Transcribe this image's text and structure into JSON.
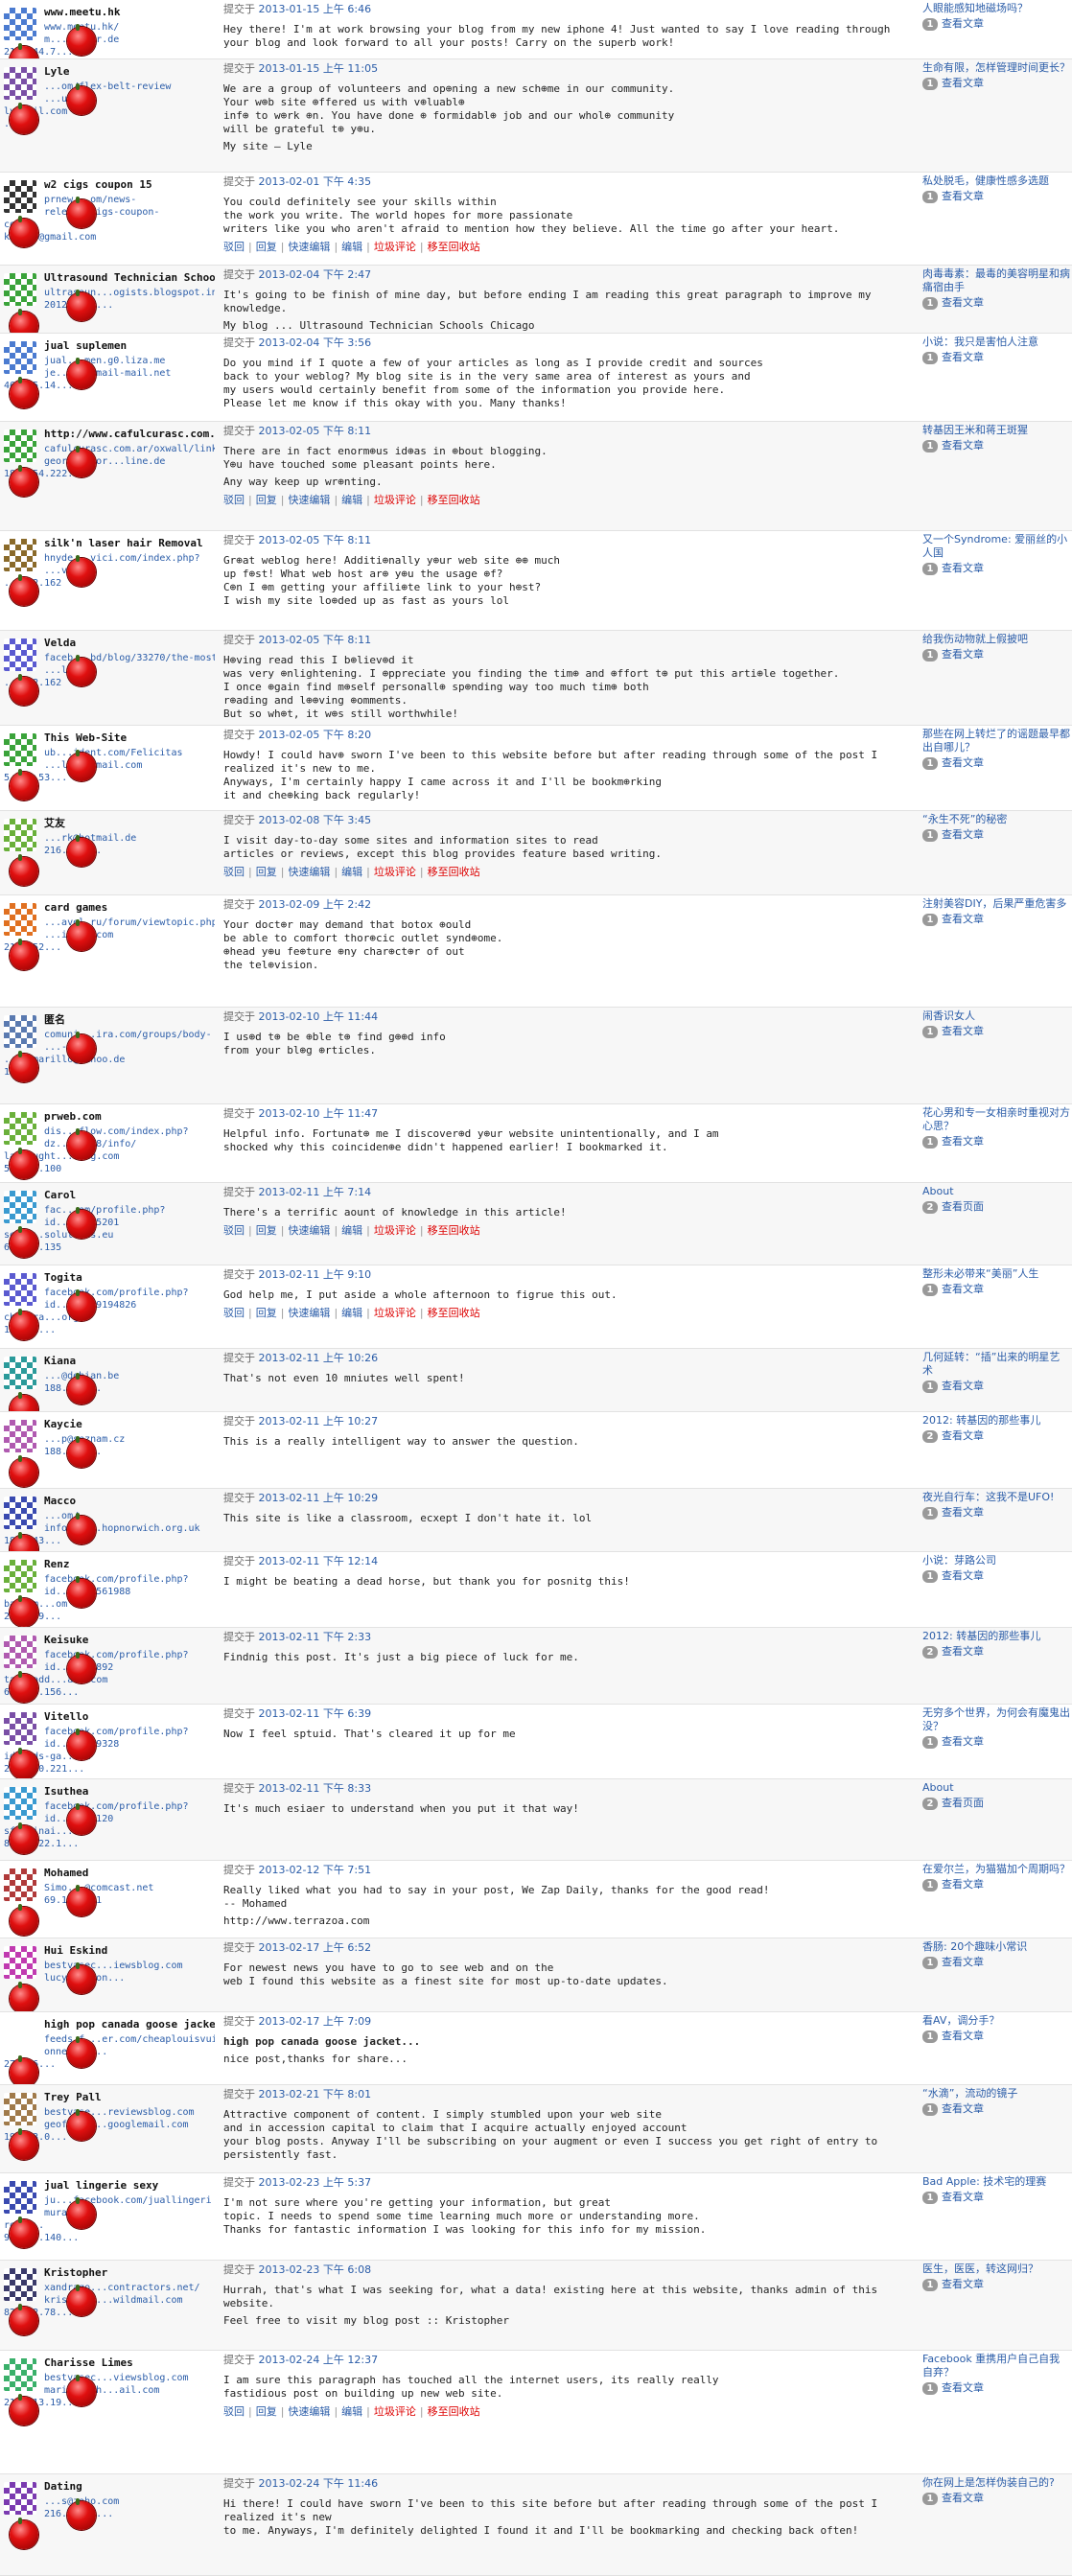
{
  "ui": {
    "submitted_prefix": "提交于",
    "actions": [
      "驳回",
      "回复",
      "快速编辑",
      "编辑",
      "垃圾评论",
      "移至回收站"
    ],
    "view_post": "查看文章",
    "view_page": "查看页面"
  },
  "rows": [
    {
      "name": "www.meetu.hk",
      "meta": [
        "www.meetu.hk/",
        "m...@arcor.de",
        "216.244.7..."
      ],
      "date": "2013-01-15 上午 6:46",
      "body": [
        "Hey there! I'm at work browsing your blog from my new iphone 4! Just wanted to say I love reading through your blog and look forward to all your posts! Carry on the superb work!"
      ],
      "actions": false,
      "post": "人眼能感知地磁场吗？",
      "count": "1",
      "view": "查看文章",
      "avatar": "#4b7bd0"
    },
    {
      "name": "Lyle",
      "meta": [
        "...om/flex-belt-review",
        "...unt",
        "ly...il.com",
        "...70"
      ],
      "date": "2013-01-15 上午 11:05",
      "body": [
        "We are a group of volunteers and op⊕ning a new sch⊕me in our community.\nYour w⊕b site ⊕ffered us with v⊕luabl⊕\ninf⊕ to w⊕rk ⊕n. You have done ⊕ formidabl⊕ job and our whol⊕ community\nwill be grateful t⊕ y⊕u.",
        "My site – Lyle"
      ],
      "actions": false,
      "post": "生命有限，怎样管理时间更长？",
      "count": "1",
      "view": "查看文章",
      "avatar": "#7a4fa6"
    },
    {
      "name": "w2 cigs coupon 15",
      "meta": [
        "prnew...om/news-",
        "relea...cigs-coupon-",
        "co/",
        "kay...@gmail.com"
      ],
      "date": "2013-02-01 下午 4:35",
      "body": [
        "You could definitely see your skills within\nthe work you write. The world hopes for more passionate\nwriters like you who aren't afraid to mention how they believe. All the time go after your heart."
      ],
      "actions": true,
      "post": "私处脱毛，健康性感多选题",
      "count": "1",
      "view": "查看文章",
      "avatar": "#333333"
    },
    {
      "name": "Ultrasound Technician Schools Chicago",
      "meta": [
        "ultrasoun...ogists.blogspot.in/",
        "2012/12/u..."
      ],
      "date": "2013-02-04 下午 2:47",
      "body": [
        "It's going to be finish of mine day, but before ending I am reading this great paragraph to improve my knowledge.",
        "My blog ... Ultrasound Technician Schools Chicago"
      ],
      "actions": false,
      "post": "肉毒毒素：最毒的美容明星和病痛宿由手",
      "count": "1",
      "view": "查看文章",
      "avatar": "#3aa33a"
    },
    {
      "name": "jual suplemen",
      "meta": [
        "jual...men.g0.liza.me",
        "je...ain@mail-mail.net",
        "46.105.14..."
      ],
      "date": "2013-02-04 下午 3:56",
      "body": [
        "Do you mind if I quote a few of your articles as long as I provide credit and sources\nback to your weblog? My blog site is in the very same area of interest as yours and\nmy users would certainly benefit from some of the information you provide here.\nPlease let me know if this okay with you. Many thanks!"
      ],
      "actions": false,
      "post": "小说：我只是害怕人注意",
      "count": "1",
      "view": "查看文章",
      "avatar": "#4b7bd0"
    },
    {
      "name": "http://www.cafulcurasc.com.ar/",
      "meta": [
        "cafulcurasc.com.ar/oxwall/link/14419",
        "georgesobor...line.de",
        "184.154.222..."
      ],
      "date": "2013-02-05 下午 8:11",
      "body": [
        "There are in fact enorm⊕us id⊕as in ⊕bout blogging.\nY⊕u have touched some pleasant points here.",
        "Any way keep up wr⊕nting."
      ],
      "actions": true,
      "post": "转基因王米和蒋王斑猩",
      "count": "1",
      "view": "查看文章",
      "avatar": "#3aa33a"
    },
    {
      "name": "silk'n laser hair Removal",
      "meta": [
        "hnyde...vici.com/index.php?",
        "...vi...",
        "...222.162"
      ],
      "date": "2013-02-05 下午 8:11",
      "body": [
        "Gr⊕at weblog here! Additi⊕nally y⊕ur web site ⊕⊕ much\nup f⊕st! What web host ar⊕ y⊕u the usage ⊕f?\nC⊕n I ⊕m getting your affili⊕te link to your h⊕st?\nI wish my site lo⊕ded up as fast as yours lol"
      ],
      "actions": false,
      "post": "又一个Syndrome: 爱丽丝的小人国",
      "count": "1",
      "view": "查看文章",
      "avatar": "#8a6a2a"
    },
    {
      "name": "Velda",
      "meta": [
        "faceb...bd/blog/33270/the-most-",
        "...l.com",
        "...222.162"
      ],
      "date": "2013-02-05 下午 8:11",
      "body": [
        "H⊕ving read this I b⊕liev⊕d it\nwas very ⊕nlightening. I ⊕ppreciate you finding the tim⊕ and ⊕ffort t⊕ put this arti⊕le together.\nI once ⊕gain find m⊕self personall⊕ sp⊕nding way too much tim⊕ both\nr⊕ading and l⊕⊕ving ⊕omments.\nBut so wh⊕t, it w⊕s still worthwhile!"
      ],
      "actions": false,
      "post": "给我伤动物就上假披吧",
      "count": "1",
      "view": "查看文章",
      "avatar": "#5a5ad0"
    },
    {
      "name": "This Web-Site",
      "meta": [
        "ub...ident.com/Felicitas",
        "...llon@gmail.com",
        "5.135.53..."
      ],
      "date": "2013-02-05 下午 8:20",
      "body": [
        "Howdy! I could hav⊕ sworn I've been to this website before but after reading through some of the post I realized it's new to me.\nAnyways, I'm certainly happy I came across it and I'll be bookm⊕rking\nit and che⊕king back regularly!"
      ],
      "actions": false,
      "post": "那些在网上转烂了的谣题最早都出自哪儿？",
      "count": "1",
      "view": "查看文章",
      "avatar": "#3aa33a"
    },
    {
      "name": "艾友",
      "meta": [
        "...rk@hotmail.de",
        "216.244..."
      ],
      "date": "2013-02-08 下午 3:45",
      "body": [
        "I visit day-to-day some sites and information sites to read\narticles or reviews, except this blog provides feature based writing."
      ],
      "actions": true,
      "post": "“永生不死”的秘密",
      "count": "1",
      "view": "查看文章",
      "avatar": "#6ab03a"
    },
    {
      "name": "card games",
      "meta": [
        "...avel.ru/forum/viewtopic.php?",
        "...inbox.com",
        "216.152..."
      ],
      "date": "2013-02-09 上午 2:42",
      "body": [
        "Your doct⊕r may demand that botox ⊕ould\nbe able to comfort thor⊕cic outlet synd⊕ome.\n⊕head y⊕u fe⊕ture ⊕ny char⊕ct⊕r of out\nthe tel⊕vision."
      ],
      "actions": false,
      "post": "注射美容DIY，后果严重危害多",
      "count": "1",
      "view": "查看文章",
      "avatar": "#e07020"
    },
    {
      "name": "匿名",
      "meta": [
        "comuni...ira.com/groups/body-",
        "...-fo...",
        "...camarillo@yahoo.de",
        "100"
      ],
      "date": "2013-02-10 上午 11:44",
      "body": [
        "I us⊕d t⊕ be ⊕ble t⊕ find g⊕⊕d info\nfrom your bl⊕g ⊕rticles."
      ],
      "actions": false,
      "post": "闹香识女人",
      "count": "1",
      "view": "查看文章",
      "avatar": "#5a7ab0"
    },
    {
      "name": "prweb.com",
      "meta": [
        "dis...flow.com/index.php?",
        "dz...e-278/info/",
        "landaught...ring.com",
        "5.39.1.100"
      ],
      "date": "2013-02-10 上午 11:47",
      "body": [
        "Helpful info. Fortunat⊕ me I discover⊕d y⊕ur website unintentionally, and I am\nshocked why this coinciden⊕e didn't happened earlier! I bookmarked it."
      ],
      "actions": false,
      "post": "花心男和专一女相亲时重视对方心思？",
      "count": "1",
      "view": "查看文章",
      "avatar": "#6ab03a"
    },
    {
      "name": "Carol",
      "meta": [
        "fac...om/profile.php?",
        "id...08985201",
        "serv...solutions.eu",
        "65.2...135"
      ],
      "date": "2013-02-11 上午 7:14",
      "body": [
        "There's a terrific aount of knowledge in this article!"
      ],
      "actions": true,
      "post": "About",
      "count": "2",
      "view": "查看页面",
      "avatar": "#3a9ad0"
    },
    {
      "name": "Togita",
      "meta": [
        "facebook.com/profile.php?",
        "id...03409194826",
        "cbsudra...org",
        "193.61..."
      ],
      "date": "2013-02-11 上午 9:10",
      "body": [
        "God help me, I put aside a whole afternoon to figrue this out."
      ],
      "actions": true,
      "post": "整形未必带来“美丽”人生",
      "count": "1",
      "view": "查看文章",
      "avatar": "#5a5ad0"
    },
    {
      "name": "Kiana",
      "meta": [
        "...@debian.be",
        "188.143..."
      ],
      "date": "2013-02-11 上午 10:26",
      "body": [
        "That's not even 10 mniutes well spent!"
      ],
      "actions": false,
      "post": "几何延转：“插”出来的明星艺术",
      "count": "1",
      "view": "查看文章",
      "avatar": "#2a9a9a"
    },
    {
      "name": "Kaycie",
      "meta": [
        "...p@seznam.cz",
        "188.143..."
      ],
      "date": "2013-02-11 上午 10:27",
      "body": [
        "This is a really intelligent way to answer the question."
      ],
      "actions": false,
      "post": "2012: 转基因的那些事儿",
      "count": "2",
      "view": "查看文章",
      "avatar": "#b05ab0"
    },
    {
      "name": "Macco",
      "meta": [
        "...om/",
        "info@le...hopnorwich.org.uk",
        "188.143..."
      ],
      "date": "2013-02-11 上午 10:29",
      "body": [
        "This site is like a classroom, ecxept I don't hate it. lol"
      ],
      "actions": false,
      "post": "夜光自行车：这我不是UFO!",
      "count": "1",
      "view": "查看文章",
      "avatar": "#3a4ab0"
    },
    {
      "name": "Renz",
      "meta": [
        "facebook.com/profile.php?",
        "id...3408561988",
        "baupam...om",
        "212.179..."
      ],
      "date": "2013-02-11 下午 12:14",
      "body": [
        "I might be beating a dead horse, but thank you for posnitg this!"
      ],
      "actions": false,
      "post": "小说：芽路公司",
      "count": "1",
      "view": "查看文章",
      "avatar": "#6ab03a"
    },
    {
      "name": "Keisuke",
      "meta": [
        "facebook.com/profile.php?",
        "id...3486892",
        "tarahadd...ail.com",
        "62.159.156..."
      ],
      "date": "2013-02-11 下午 2:33",
      "body": [
        "Findnig this post. It's just a big piece of luck for me."
      ],
      "actions": false,
      "post": "2012: 转基因的那些事儿",
      "count": "2",
      "view": "查看文章",
      "avatar": "#b05ab0"
    },
    {
      "name": "Vitello",
      "meta": [
        "facebook.com/profile.php?",
        "id...10539328",
        "ids@ids-ga...om",
        "221.120.221..."
      ],
      "date": "2013-02-11 下午 6:39",
      "body": [
        "Now I feel sptuid. That's cleared it up for me"
      ],
      "actions": false,
      "post": "无穷多个世界，为何会有魔鬼出没？",
      "count": "1",
      "view": "查看文章",
      "avatar": "#7a4fa6"
    },
    {
      "name": "Isuthea",
      "meta": [
        "facebook.com/profile.php?",
        "id...0495120",
        "sfa-finai...ru",
        "86.98.22.1..."
      ],
      "date": "2013-02-11 下午 8:33",
      "body": [
        "It's much esiaer to understand when you put it that way!"
      ],
      "actions": false,
      "post": "About",
      "count": "2",
      "view": "查看页面",
      "avatar": "#3a9ad0"
    },
    {
      "name": "Mohamed",
      "meta": [
        "Simo...@comcast.net",
        "69.1...101"
      ],
      "date": "2013-02-12 下午 7:51",
      "body": [
        "Really liked what you had to say in your post, We Zap Daily, thanks for the good read!\n-- Mohamed",
        "http://www.terrazoa.com"
      ],
      "actions": false,
      "post": "在爱尔兰，为猫猫加个周期吗？",
      "count": "1",
      "view": "查看文章",
      "avatar": "#b03a3a"
    },
    {
      "name": "Hui Eskind",
      "meta": [
        "bestvasec...iewsblog.com",
        "lucy_poston..."
      ],
      "date": "2013-02-17 上午 6:52",
      "body": [
        "For newest news you have to go to see web and on the\nweb I found this website as a finest site for most up-to-date updates."
      ],
      "actions": false,
      "post": "香肠: 20个趣味小常识",
      "count": "1",
      "view": "查看文章",
      "avatar": "#c03ab0"
    },
    {
      "name": "high pop canada goose jacket",
      "meta": [
        "feeds.f...er.com/cheaplouisvuitt",
        "onneplis...",
        "27.226..."
      ],
      "date": "2013-02-17 上午 7:09",
      "body": [
        "high pop canada goose jacket...",
        "nice post,thanks for share..."
      ],
      "actions": false,
      "post": "看AV，调分手？",
      "count": "1",
      "view": "查看文章",
      "avatar": "#ffffff"
    },
    {
      "name": "Trey Pall",
      "meta": [
        "bestvase...reviewsblog.com",
        "geoffrey...googlemail.com",
        "199.83.0..."
      ],
      "date": "2013-02-21 下午 8:01",
      "body": [
        "Attractive component of content. I simply stumbled upon your web site\nand in accession capital to claim that I acquire actually enjoyed account\nyour blog posts. Anyway I'll be subscribing on your augment or even I success you get right of entry to persistently fast."
      ],
      "actions": false,
      "post": "“水滴”，流动的镜子",
      "count": "1",
      "view": "查看文章",
      "avatar": "#a07a4a"
    },
    {
      "name": "jual lingerie sexy",
      "meta": [
        "ju...facebook.com/juallingeri",
        "mura...",
        "rosa...",
        "96.127.140..."
      ],
      "date": "2013-02-23 上午 5:37",
      "body": [
        "I'm not sure where you're getting your information, but great\ntopic. I needs to spend some time learning much more or understanding more.\nThanks for fantastic information I was looking for this info for my mission."
      ],
      "actions": false,
      "post": "Bad Apple: 技术宅的理赛",
      "count": "1",
      "view": "查看文章",
      "avatar": "#3a4ab0"
    },
    {
      "name": "Kristopher",
      "meta": [
        "xandrago...contractors.net/",
        "kristophe...wildmail.com",
        "82.192.78..."
      ],
      "date": "2013-02-23 下午 6:08",
      "body": [
        "Hurrah, that's what I was seeking for, what a data! existing here at this website, thanks admin of this website.",
        "Feel free to visit my blog post :: Kristopher"
      ],
      "actions": false,
      "post": "医生，医医，转这网归？",
      "count": "1",
      "view": "查看文章",
      "avatar": "#3a3a6a"
    },
    {
      "name": "Charisse Limes",
      "meta": [
        "bestvasec...viewsblog.com",
        "mariam-sch...ail.com",
        "216.213.19..."
      ],
      "date": "2013-02-24 上午 12:37",
      "body": [
        "I am sure this paragraph has touched all the internet users, its really really\nfastidious post on building up new web site."
      ],
      "actions": true,
      "post": "Facebook 重携用户自己自我自弃？",
      "count": "1",
      "view": "查看文章",
      "avatar": "#3ab06a"
    },
    {
      "name": "Dating",
      "meta": [
        "...s@zoho.com",
        "216.244.7..."
      ],
      "date": "2013-02-24 下午 11:46",
      "body": [
        "Hi there! I could have sworn I've been to this site before but after reading through some of the post I realized it's new\nto me. Anyways, I'm definitely delighted I found it and I'll be bookmarking and checking back often!"
      ],
      "actions": false,
      "post": "你在网上是怎样伪装自己的?",
      "count": "1",
      "view": "查看文章",
      "avatar": "#7a3ab0"
    }
  ]
}
